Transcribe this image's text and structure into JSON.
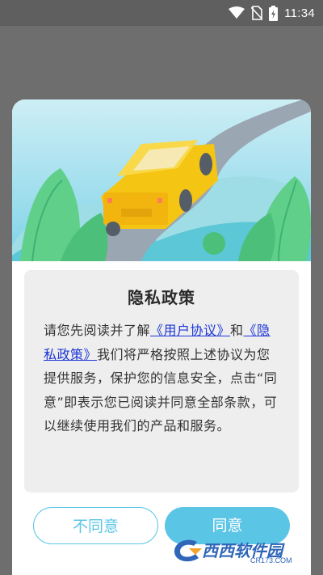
{
  "status_bar": {
    "time": "11:34",
    "icons": [
      "wifi-icon",
      "no-sim-icon",
      "battery-charging-icon"
    ]
  },
  "dialog": {
    "title": "隐私政策",
    "text": {
      "intro": "请您先阅读并了解",
      "link_user_agreement": "《用户协议》",
      "and": "和",
      "link_privacy_policy": "《隐私政策》",
      "body": "我们将严格按照上述协议为您提供服务，保护您的信息安全，点击“同意”即表示您已阅读并同意全部条款，可以继续使用我们的产品和服务。"
    },
    "buttons": {
      "disagree": "不同意",
      "agree": "同意"
    }
  },
  "watermark": {
    "name": "西西软件园",
    "url": "CR173.COM"
  },
  "colors": {
    "accent": "#5bc5e6",
    "link": "#1c36d6",
    "scrim": "#6e6e6e"
  }
}
